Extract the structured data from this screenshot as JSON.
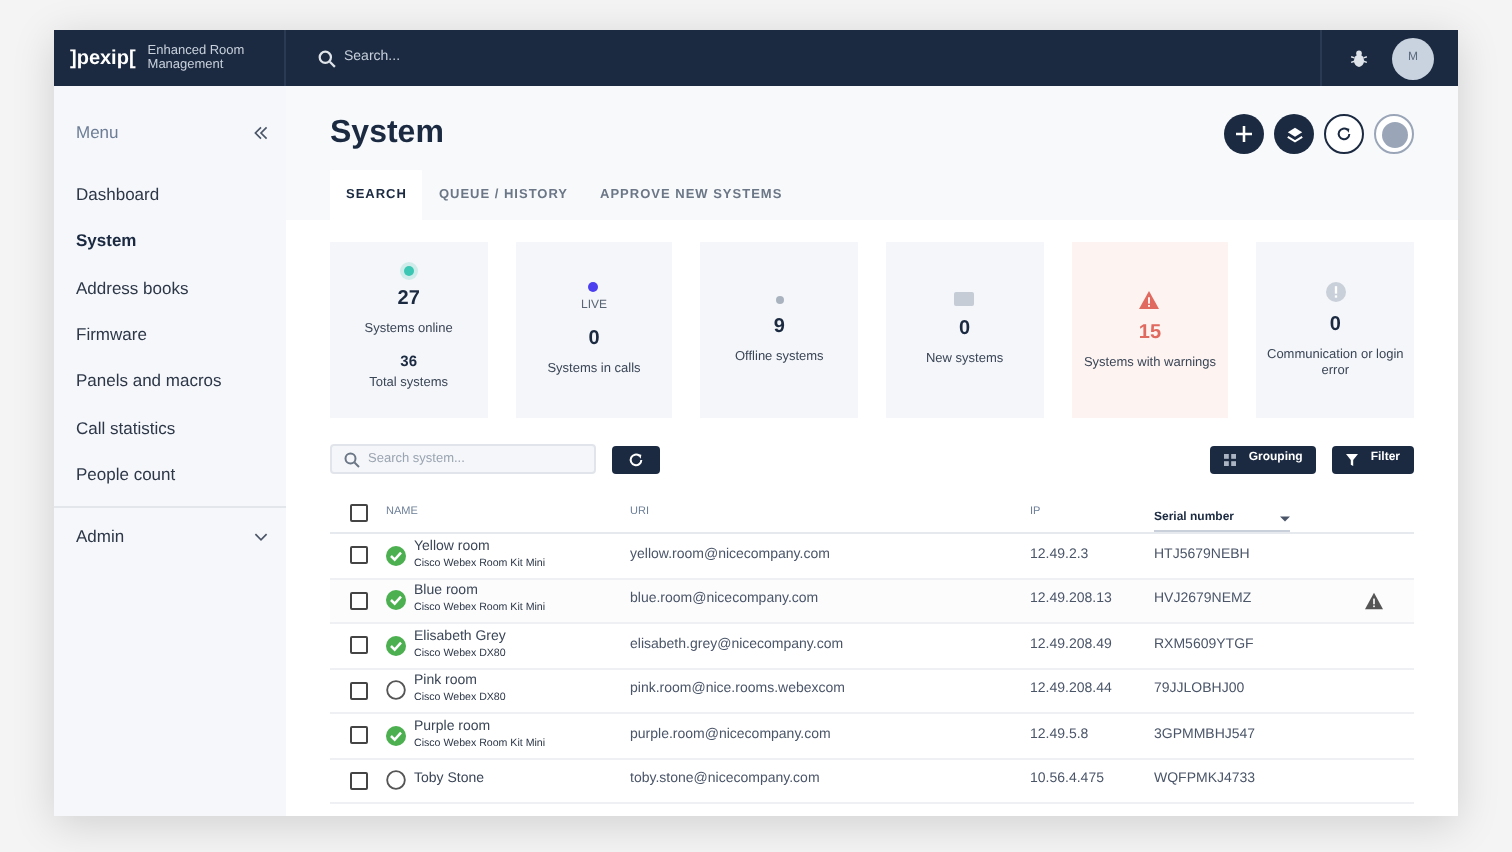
{
  "header": {
    "logo": "]pexip[",
    "product": "Enhanced Room Management",
    "search": {
      "placeholder": "Search..."
    },
    "avatar": "M"
  },
  "sidebar": {
    "title": "Menu",
    "items": [
      {
        "label": "Dashboard",
        "selected": false
      },
      {
        "label": "System",
        "selected": true
      },
      {
        "label": "Address books",
        "selected": false
      },
      {
        "label": "Firmware",
        "selected": false
      },
      {
        "label": "Panels and macros",
        "selected": false
      },
      {
        "label": "Call statistics",
        "selected": false
      },
      {
        "label": "People count",
        "selected": false
      }
    ],
    "admin": {
      "label": "Admin",
      "expanded": false
    }
  },
  "page": {
    "title": "System"
  },
  "tabs": [
    {
      "label": "SEARCH",
      "selected": true
    },
    {
      "label": "QUEUE / HISTORY",
      "selected": false
    },
    {
      "label": "APPROVE NEW SYSTEMS",
      "selected": false
    }
  ],
  "stats": [
    {
      "kind": "online",
      "color": "#3cc6b4",
      "value": "27",
      "label": "Systems online",
      "extra_value": "36",
      "extra_label": "Total systems"
    },
    {
      "kind": "live",
      "color": "#4b3ff0",
      "badge": "LIVE",
      "value": "0",
      "label": "Systems in calls"
    },
    {
      "kind": "offline",
      "color": "#a9b3bf",
      "value": "9",
      "label": "Offline systems"
    },
    {
      "kind": "new",
      "value": "0",
      "label": "New systems"
    },
    {
      "kind": "warning",
      "value": "15",
      "label": "Systems with warnings"
    },
    {
      "kind": "error",
      "value": "0",
      "label": "Communication or login error"
    }
  ],
  "toolbar": {
    "search": {
      "placeholder": "Search system..."
    },
    "grouping": "Grouping",
    "filter": "Filter"
  },
  "table": {
    "select_all_checked": false,
    "columns": [
      "NAME",
      "URI",
      "IP"
    ],
    "sort": "Serial number",
    "rows": [
      {
        "checked": false,
        "online": true,
        "name": "Yellow room",
        "model": "Cisco Webex Room Kit Mini",
        "uri": "yellow.room@nicecompany.com",
        "ip": "12.49.2.3",
        "serial": "HTJ5679NEBH",
        "warning": false
      },
      {
        "checked": false,
        "online": true,
        "name": "Blue room",
        "model": "Cisco Webex Room Kit Mini",
        "uri": "blue.room@nicecompany.com",
        "ip": "12.49.208.13",
        "serial": "HVJ2679NEMZ",
        "warning": true
      },
      {
        "checked": false,
        "online": true,
        "name": "Elisabeth Grey",
        "model": "Cisco Webex DX80",
        "uri": "elisabeth.grey@nicecompany.com",
        "ip": "12.49.208.49",
        "serial": "RXM5609YTGF",
        "warning": false
      },
      {
        "checked": false,
        "online": false,
        "name": "Pink room",
        "model": "Cisco Webex DX80",
        "uri": "pink.room@nice.rooms.webexcom",
        "ip": "12.49.208.44",
        "serial": "79JJLOBHJ00",
        "warning": false
      },
      {
        "checked": false,
        "online": true,
        "name": "Purple room",
        "model": "Cisco Webex Room Kit Mini",
        "uri": "purple.room@nicecompany.com",
        "ip": "12.49.5.8",
        "serial": "3GPMMBHJ547",
        "warning": false
      },
      {
        "checked": false,
        "online": false,
        "name": "Toby Stone",
        "uri": "toby.stone@nicecompany.com",
        "ip": "10.56.4.475",
        "serial": "WQFPMKJ4733",
        "warning": false
      }
    ]
  }
}
